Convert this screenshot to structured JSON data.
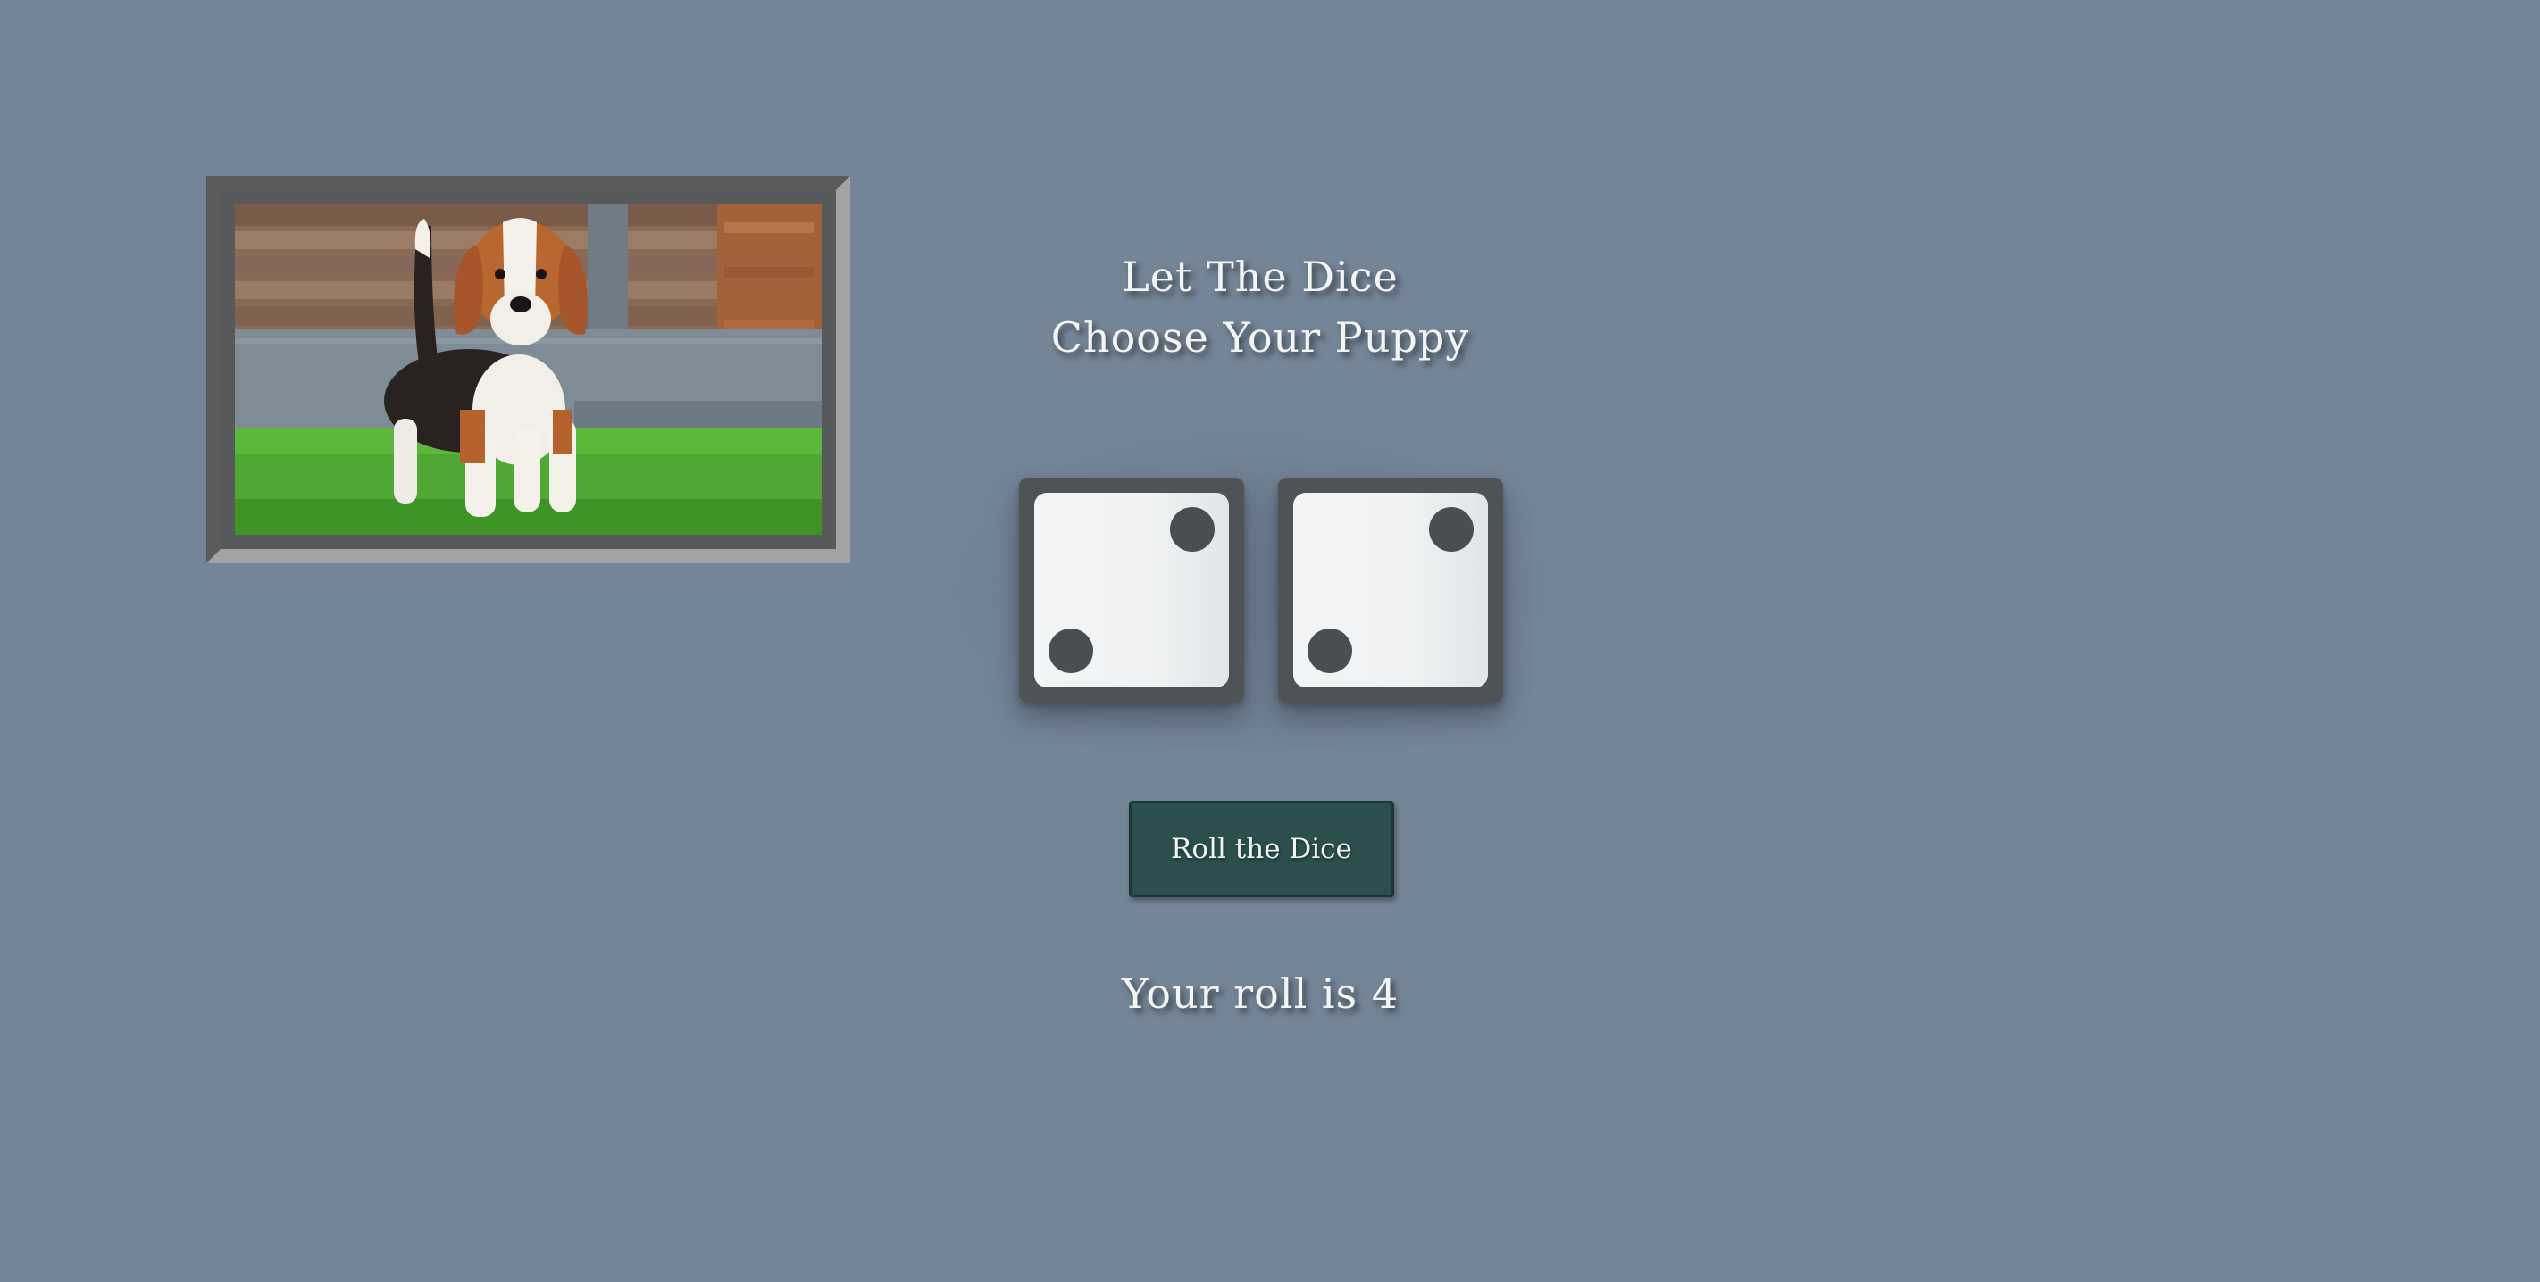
{
  "heading": {
    "line1": "Let The Dice",
    "line2": "Choose Your Puppy"
  },
  "picture": {
    "subject": "beagle-puppy-photo"
  },
  "dice": [
    {
      "value": 2
    },
    {
      "value": 2
    }
  ],
  "roll_button": {
    "label": "Roll the Dice"
  },
  "result": {
    "text": "Your roll is 4"
  },
  "colors": {
    "background": "#748598",
    "button": "#2b4f4e",
    "die_body": "#505355",
    "die_face": "#f2f4f5",
    "pip": "#4b4e50"
  }
}
